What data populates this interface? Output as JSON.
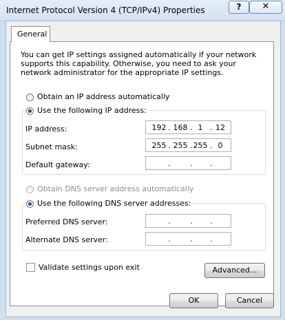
{
  "window": {
    "title": "Internet Protocol Version 4 (TCP/IPv4) Properties",
    "help_label": "?",
    "close_label": "✕"
  },
  "tab": {
    "label": "General"
  },
  "intro_text": "You can get IP settings assigned automatically if your network supports this capability. Otherwise, you need to ask your network administrator for the appropriate IP settings.",
  "ip_section": {
    "auto_label": "Obtain an IP address automatically",
    "auto_selected": false,
    "manual_label": "Use the following IP address:",
    "manual_selected": true,
    "fields": [
      {
        "label": "IP address:",
        "octets": [
          "192",
          "168",
          "1",
          "12"
        ]
      },
      {
        "label": "Subnet mask:",
        "octets": [
          "255",
          "255",
          "255",
          "0"
        ]
      },
      {
        "label": "Default gateway:",
        "octets": [
          "",
          "",
          "",
          ""
        ]
      }
    ]
  },
  "dns_section": {
    "auto_label": "Obtain DNS server address automatically",
    "auto_enabled": false,
    "manual_label": "Use the following DNS server addresses:",
    "manual_selected": true,
    "fields": [
      {
        "label": "Preferred DNS server:",
        "octets": [
          "",
          "",
          "",
          ""
        ]
      },
      {
        "label": "Alternate DNS server:",
        "octets": [
          "",
          "",
          "",
          ""
        ]
      }
    ]
  },
  "validate_label": "Validate settings upon exit",
  "validate_checked": false,
  "buttons": {
    "advanced": "Advanced...",
    "ok": "OK",
    "cancel": "Cancel"
  },
  "colors": {
    "title_bar": "#d3e2f3",
    "radio_dot": "#1a4d94"
  },
  "icons": {
    "help": "help-icon",
    "close": "close-icon"
  }
}
